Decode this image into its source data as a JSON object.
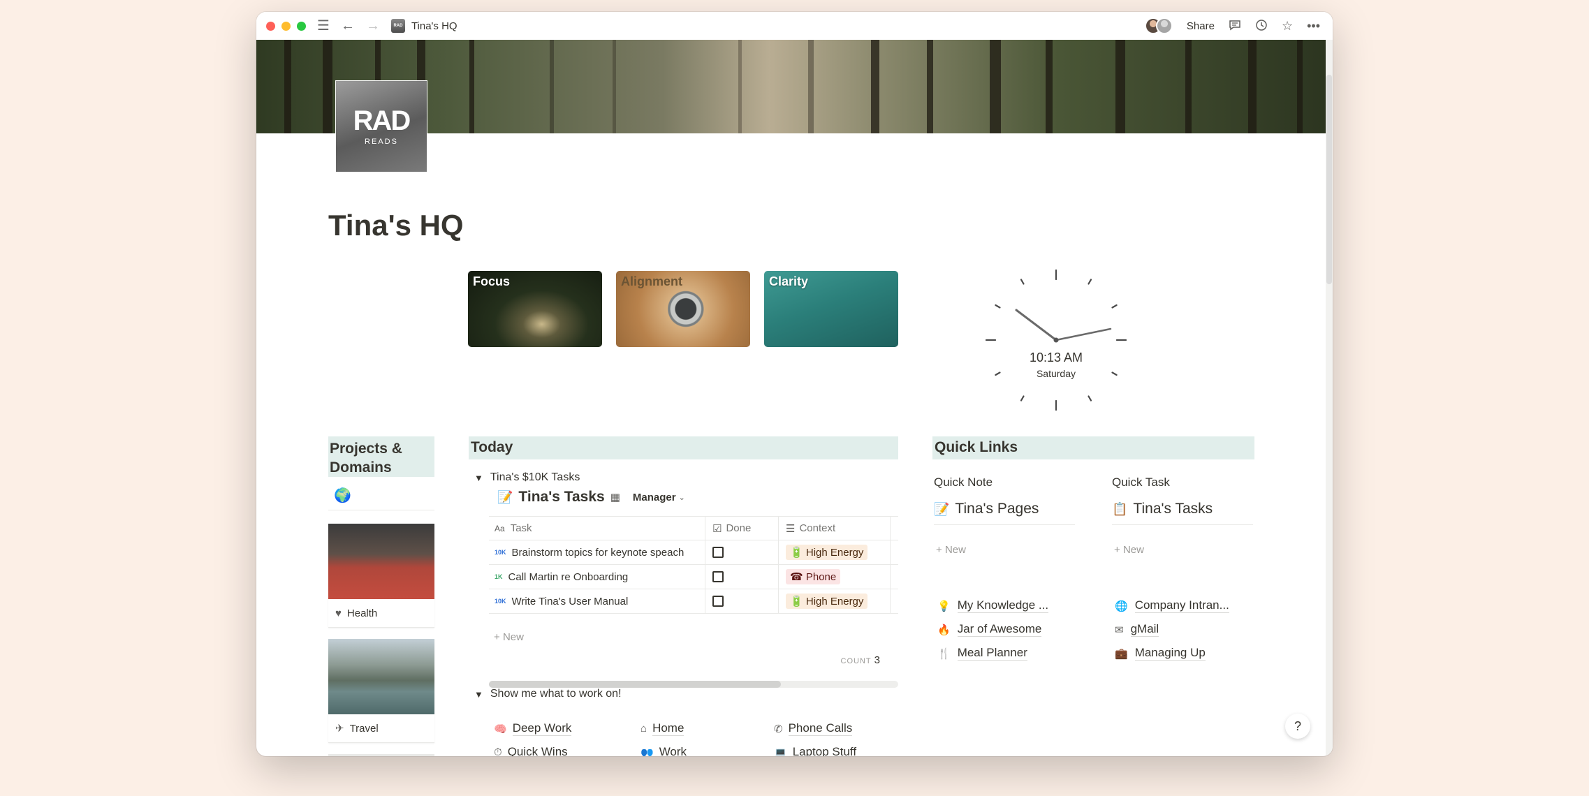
{
  "titlebar": {
    "title": "Tina's HQ",
    "share_label": "Share"
  },
  "page": {
    "icon_text": "RAD",
    "icon_subtext": "READS",
    "title": "Tina's HQ"
  },
  "gallery": [
    {
      "label": "Focus"
    },
    {
      "label": "Alignment"
    },
    {
      "label": "Clarity"
    }
  ],
  "clock": {
    "time": "10:13 AM",
    "day": "Saturday"
  },
  "projects": {
    "header": "Projects & Domains",
    "cards": [
      {
        "label": "Health",
        "icon": "heart-icon"
      },
      {
        "label": "Travel",
        "icon": "plane-icon"
      }
    ]
  },
  "today": {
    "header": "Today",
    "toggle1": "Tina's $10K Tasks",
    "db_title": "Tina's Tasks",
    "view_label": "Manager",
    "columns": [
      "Task",
      "Done",
      "Context"
    ],
    "rows": [
      {
        "badge": "10K",
        "task": "Brainstorm topics for keynote speach",
        "context": "High Energy"
      },
      {
        "badge": "1K",
        "task": "Call Martin re Onboarding",
        "context": "Phone"
      },
      {
        "badge": "10K",
        "task": "Write Tina's User Manual",
        "context": "High Energy"
      }
    ],
    "new_label": "New",
    "count_label": "COUNT",
    "count_value": "3",
    "toggle2": "Show me what to work on!",
    "work_links": [
      "Deep Work",
      "Home",
      "Phone Calls",
      "Quick Wins",
      "Work",
      "Laptop Stuff"
    ]
  },
  "quick_links": {
    "header": "Quick Links",
    "note_label": "Quick Note",
    "task_label": "Quick Task",
    "note_db": "Tina's Pages",
    "task_db": "Tina's Tasks",
    "new_label": "New",
    "links_left": [
      "My Knowledge ...",
      "Jar of Awesome",
      "Meal Planner"
    ],
    "links_right": [
      "Company Intran...",
      "gMail",
      "Managing Up"
    ]
  },
  "help_label": "?"
}
